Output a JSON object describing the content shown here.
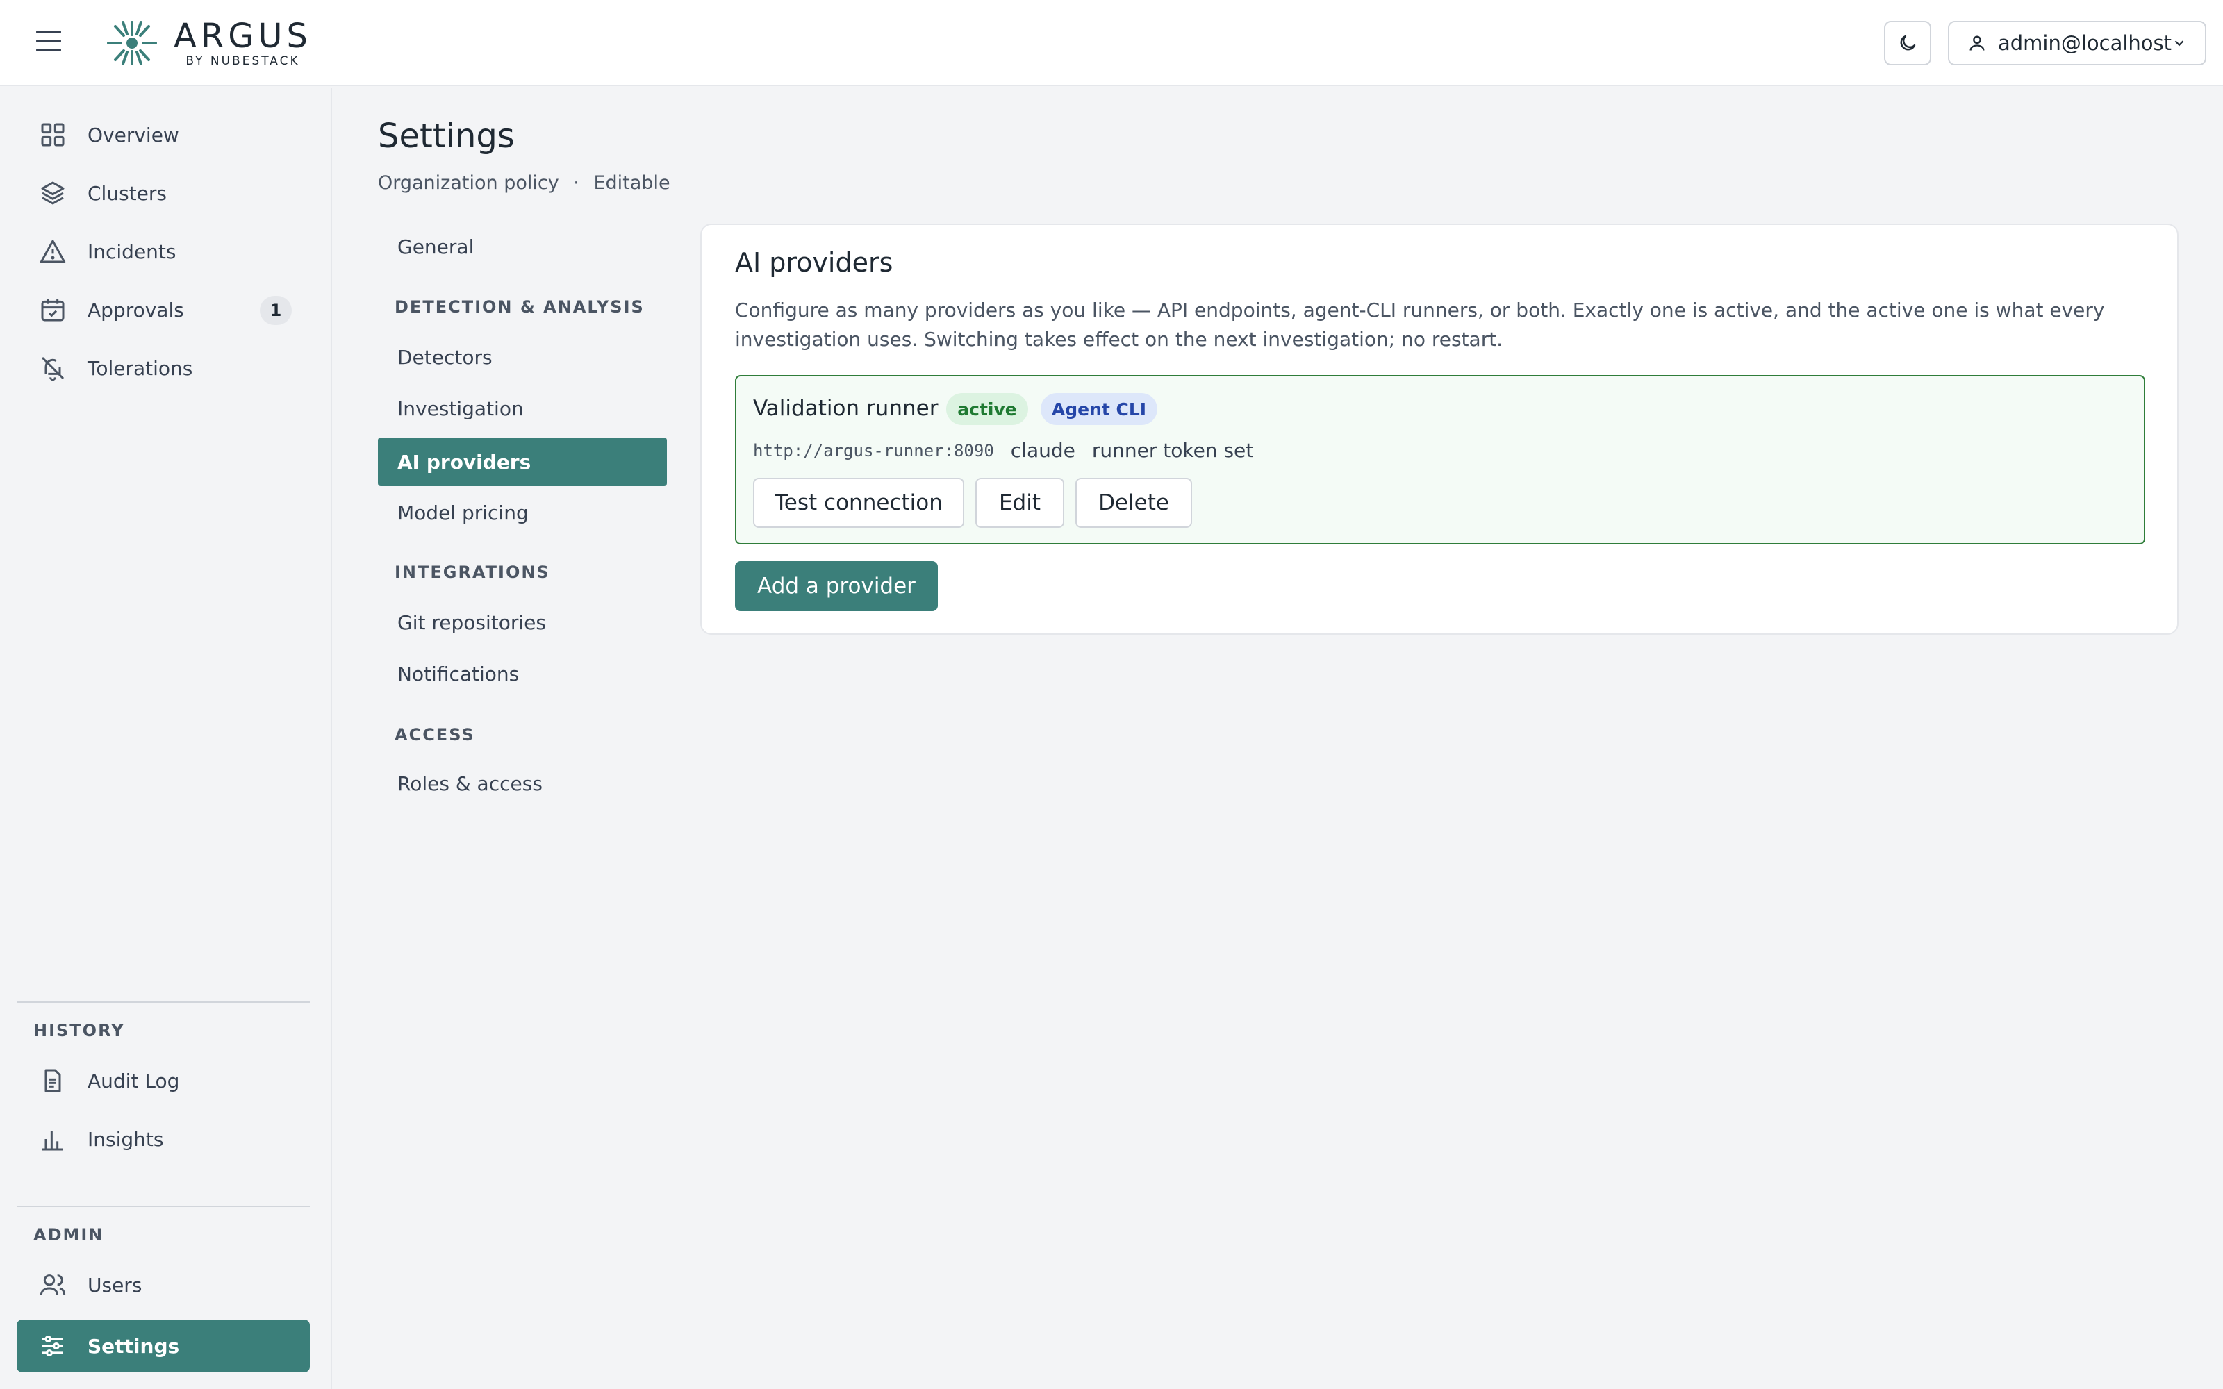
{
  "app": {
    "name": "ARGUS",
    "byline": "BY NUBESTACK",
    "user_label": "admin@localhost"
  },
  "sidebar": {
    "main_items": [
      {
        "label": "Overview",
        "icon": "grid-icon"
      },
      {
        "label": "Clusters",
        "icon": "layers-icon"
      },
      {
        "label": "Incidents",
        "icon": "warning-icon"
      },
      {
        "label": "Approvals",
        "icon": "calendar-check-icon",
        "badge": "1"
      },
      {
        "label": "Tolerations",
        "icon": "bell-off-icon"
      }
    ],
    "history_heading": "HISTORY",
    "history_items": [
      {
        "label": "Audit Log",
        "icon": "document-icon"
      },
      {
        "label": "Insights",
        "icon": "bar-chart-icon"
      }
    ],
    "admin_heading": "ADMIN",
    "admin_items": [
      {
        "label": "Users",
        "icon": "users-icon"
      },
      {
        "label": "Settings",
        "icon": "sliders-icon",
        "active": true
      }
    ]
  },
  "page": {
    "title": "Settings",
    "scope": "Organization policy",
    "separator": "·",
    "mode": "Editable"
  },
  "settings_nav": {
    "general": "General",
    "detection_heading": "DETECTION & ANALYSIS",
    "detection_items": [
      "Detectors",
      "Investigation",
      "AI providers",
      "Model pricing"
    ],
    "integrations_heading": "INTEGRATIONS",
    "integrations_items": [
      "Git repositories",
      "Notifications"
    ],
    "access_heading": "ACCESS",
    "access_items": [
      "Roles & access"
    ],
    "active": "AI providers"
  },
  "ai_providers": {
    "title": "AI providers",
    "description": "Configure as many providers as you like — API endpoints, agent-CLI runners, or both. Exactly one is active, and the active one is what every investigation uses. Switching takes effect on the next investigation; no restart.",
    "providers": [
      {
        "name": "Validation runner",
        "status_badge": "active",
        "type_badge": "Agent CLI",
        "url": "http://argus-runner:8090",
        "agent": "claude",
        "token_status": "runner token set",
        "actions": {
          "test": "Test connection",
          "edit": "Edit",
          "delete": "Delete"
        }
      }
    ],
    "add_label": "Add a provider"
  },
  "colors": {
    "accent": "#3b7f7a",
    "active_border": "#2f7d3a",
    "active_badge_text": "#1f7a32",
    "cli_badge_text": "#2546a8"
  }
}
